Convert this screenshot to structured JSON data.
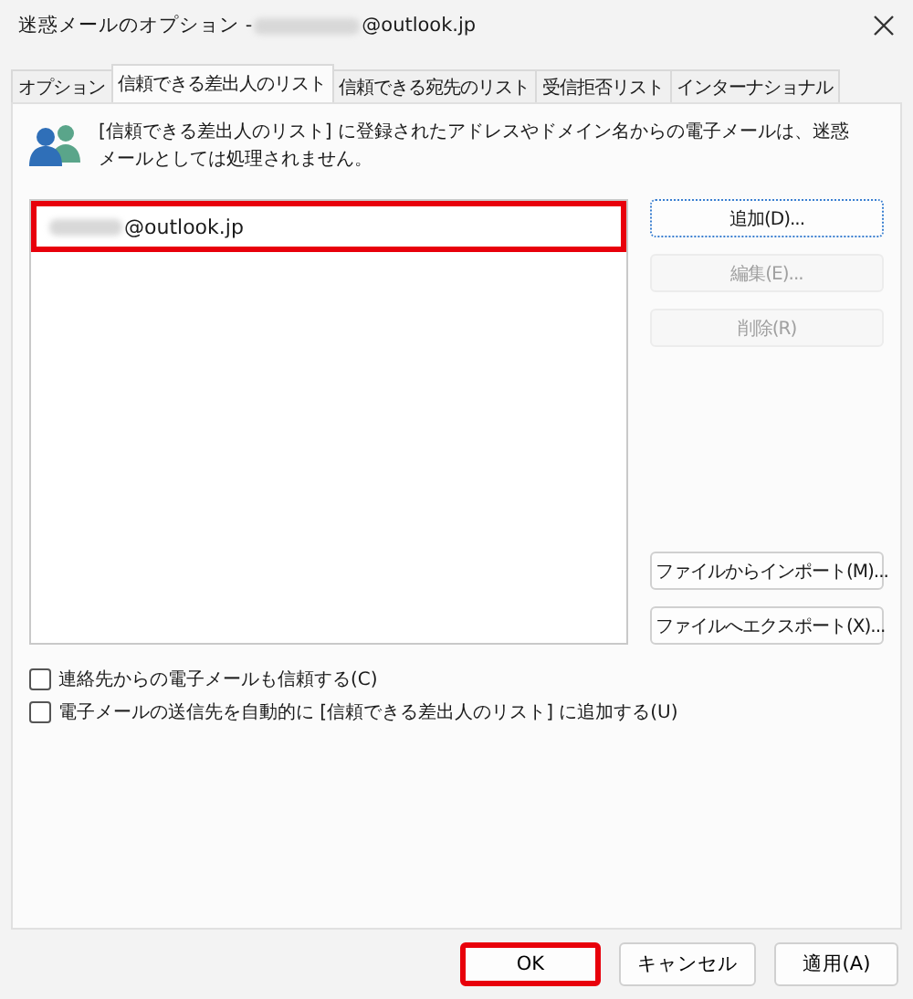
{
  "window": {
    "title_prefix": "迷惑メールのオプション - ",
    "title_suffix": "@outlook.jp",
    "title_redacted": true
  },
  "tabs": [
    {
      "label": "オプション",
      "selected": false
    },
    {
      "label": "信頼できる差出人のリスト",
      "selected": true
    },
    {
      "label": "信頼できる宛先のリスト",
      "selected": false
    },
    {
      "label": "受信拒否リスト",
      "selected": false
    },
    {
      "label": "インターナショナル",
      "selected": false
    }
  ],
  "description": "[信頼できる差出人のリスト] に登録されたアドレスやドメイン名からの電子メールは、迷惑メールとしては処理されません。",
  "list": [
    {
      "text": "@outlook.jp",
      "redacted": true,
      "highlighted": true
    }
  ],
  "side_buttons": [
    {
      "label": "追加(D)...",
      "disabled": false,
      "focused": true
    },
    {
      "label": "編集(E)...",
      "disabled": true,
      "focused": false
    },
    {
      "label": "削除(R)",
      "disabled": true,
      "focused": false
    }
  ],
  "file_buttons": [
    {
      "label": "ファイルからインポート(M)..."
    },
    {
      "label": "ファイルへエクスポート(X)..."
    }
  ],
  "options": [
    {
      "label": "連絡先からの電子メールも信頼する(C)",
      "checked": false
    },
    {
      "label": "電子メールの送信先を自動的に [信頼できる差出人のリスト] に追加する(U)",
      "checked": false
    }
  ],
  "footer_buttons": [
    {
      "label": "OK",
      "highlighted": true
    },
    {
      "label": "キャンセル",
      "highlighted": false
    },
    {
      "label": "適用(A)",
      "highlighted": false
    }
  ]
}
